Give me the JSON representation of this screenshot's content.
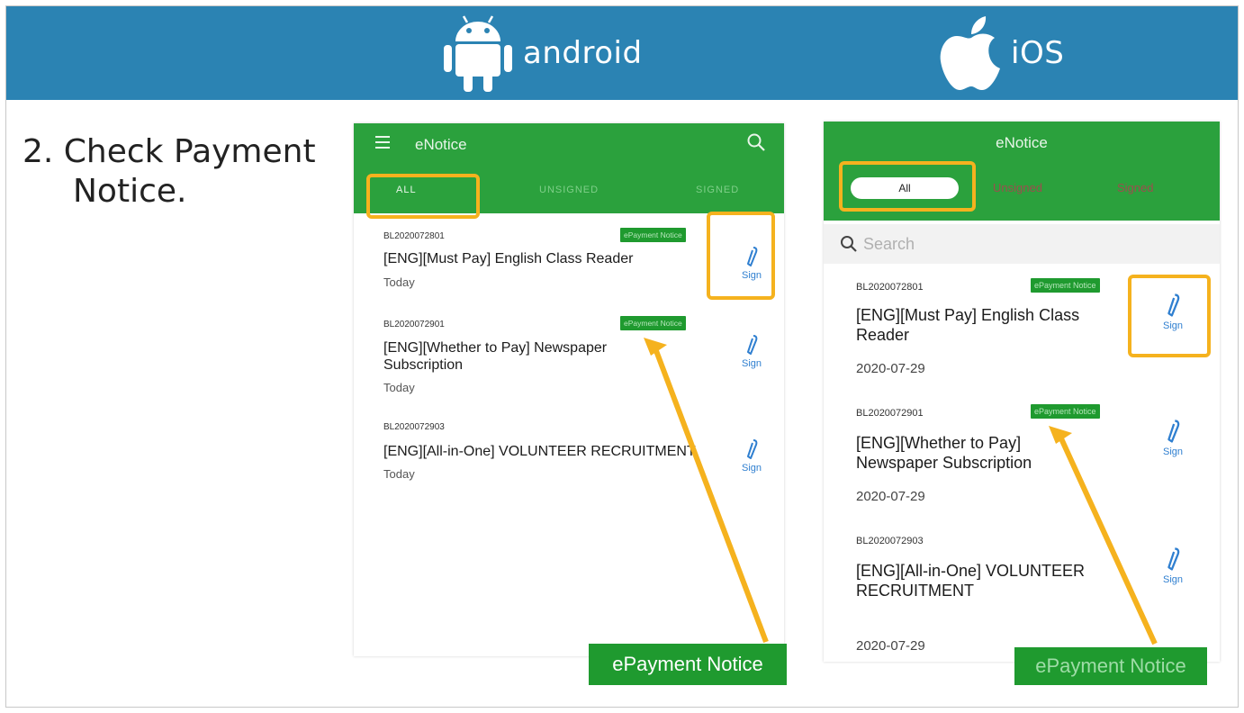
{
  "banner": {
    "android_label": "android",
    "ios_label": "iOS"
  },
  "step": {
    "line1": "2. Check Payment",
    "line2": "Notice."
  },
  "android": {
    "title": "eNotice",
    "tabs": [
      "ALL",
      "UNSIGNED",
      "SIGNED"
    ],
    "items": [
      {
        "id": "BL2020072801",
        "badge": "ePayment Notice",
        "title": "[ENG][Must Pay] English Class Reader",
        "date": "Today",
        "sign": "Sign"
      },
      {
        "id": "BL2020072901",
        "badge": "ePayment Notice",
        "title": "[ENG][Whether to Pay] Newspaper Subscription",
        "date": "Today",
        "sign": "Sign"
      },
      {
        "id": "BL2020072903",
        "badge": "",
        "title": "[ENG][All-in-One] VOLUNTEER RECRUITMENT",
        "date": "Today",
        "sign": "Sign"
      }
    ],
    "callout": "ePayment Notice"
  },
  "ios": {
    "title": "eNotice",
    "segments": [
      "All",
      "Unsigned",
      "Signed"
    ],
    "search_placeholder": "Search",
    "items": [
      {
        "id": "BL2020072801",
        "badge": "ePayment Notice",
        "title": "[ENG][Must Pay] English Class Reader",
        "date": "2020-07-29",
        "sign": "Sign"
      },
      {
        "id": "BL2020072901",
        "badge": "ePayment Notice",
        "title": "[ENG][Whether to Pay] Newspaper Subscription",
        "date": "2020-07-29",
        "sign": "Sign"
      },
      {
        "id": "BL2020072903",
        "badge": "",
        "title": "[ENG][All-in-One] VOLUNTEER RECRUITMENT",
        "date": "2020-07-29",
        "sign": "Sign"
      }
    ],
    "callout": "ePayment Notice"
  },
  "colors": {
    "banner": "#2b83b3",
    "app_green": "#2ba13d",
    "highlight": "#f5b21e",
    "sign_blue": "#2f7fd0"
  },
  "icons": {
    "android_logo": "android-robot-icon",
    "ios_logo": "apple-icon",
    "menu": "hamburger-menu-icon",
    "search": "magnifier-icon",
    "sign": "pen-icon"
  }
}
